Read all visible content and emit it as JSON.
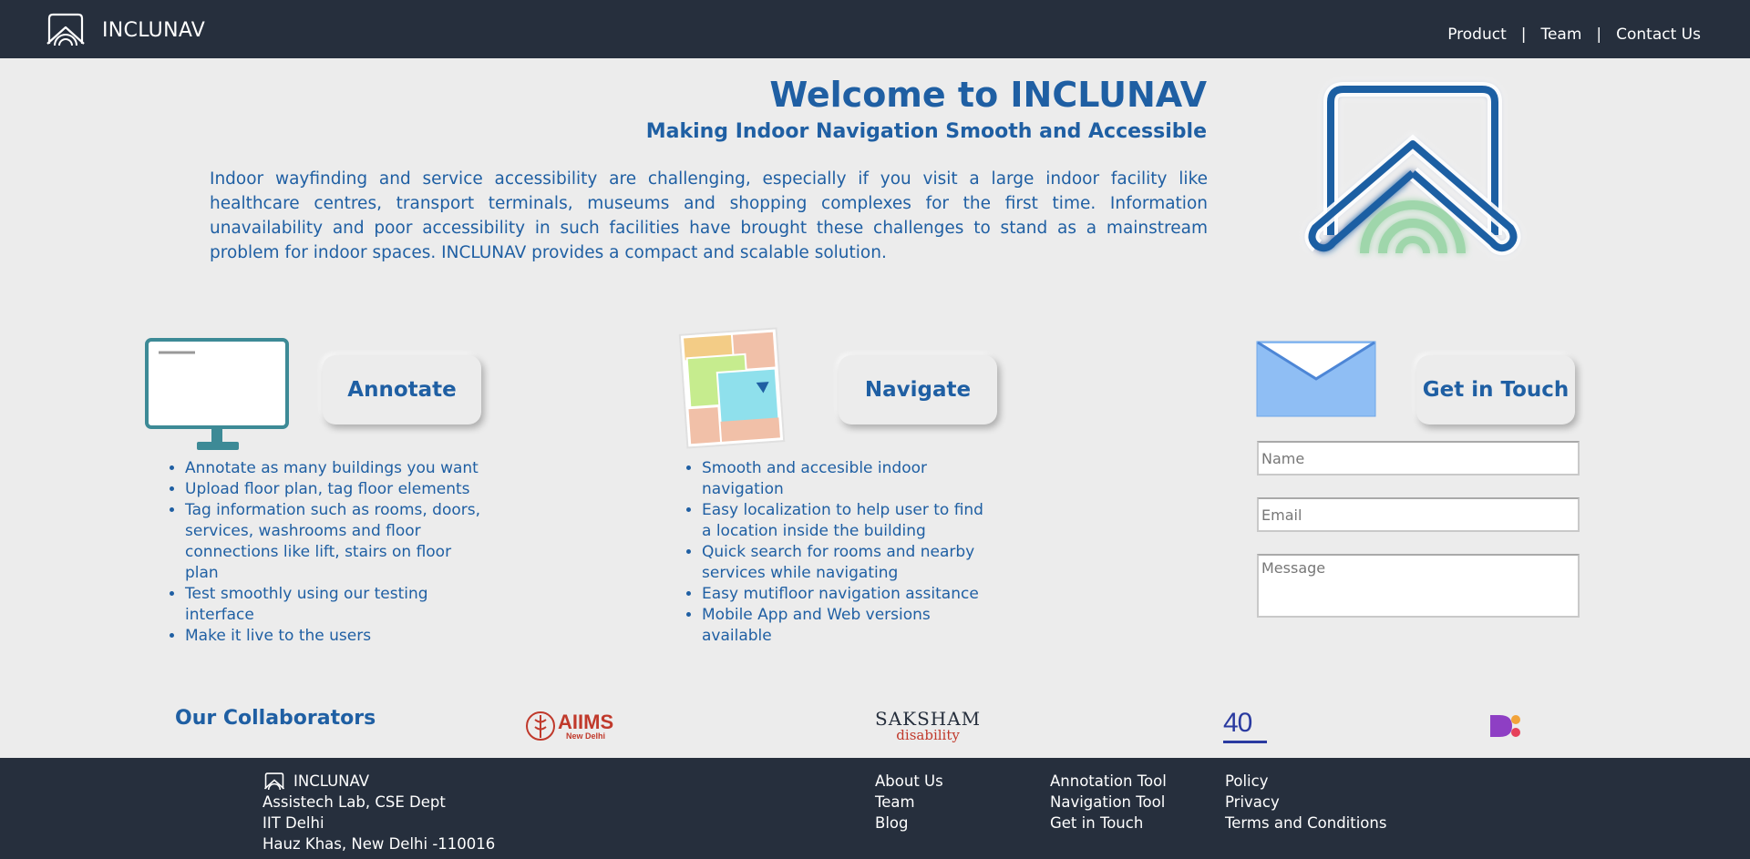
{
  "header": {
    "brand": "INCLUNAV",
    "nav": [
      "Product",
      "Team",
      "Contact Us"
    ],
    "separator": "|"
  },
  "hero": {
    "title": "Welcome to INCLUNAV",
    "subtitle": "Making Indoor Navigation Smooth and Accessible",
    "description": "Indoor wayfinding and service accessibility are challenging, especially if you visit a large indoor facility like healthcare centres, transport terminals, museums and shopping complexes for the first time. Information unavailability and poor accessibility in such facilities have brought these challenges to stand as a mainstream problem for indoor spaces. INCLUNAV provides a compact and scalable solution."
  },
  "features": {
    "annotate": {
      "button": "Annotate",
      "items": [
        "Annotate as many buildings you want",
        "Upload floor plan, tag floor elements",
        "Tag information such as rooms, doors, services, washrooms and floor connections like lift, stairs on floor plan",
        "Test smoothly using our testing interface",
        "Make it live to the users"
      ]
    },
    "navigate": {
      "button": "Navigate",
      "items": [
        "Smooth and accesible indoor navigation",
        "Easy localization to help user to find a location inside the building",
        "Quick search for rooms and nearby services while navigating",
        "Easy mutifloor navigation assitance",
        "Mobile App and Web versions available"
      ]
    },
    "contact": {
      "button": "Get in Touch",
      "name_placeholder": "Name",
      "email_placeholder": "Email",
      "message_placeholder": "Message"
    }
  },
  "collaborators": {
    "title": "Our Collaborators",
    "logos": [
      {
        "icon": "aiims-logo",
        "text": "AIIMS",
        "subtext": "New Delhi"
      },
      {
        "icon": "saksham-logo",
        "text": "SAKSHAM",
        "subtext": "disability"
      },
      {
        "icon": "40-years-logo",
        "text": "40"
      },
      {
        "icon": "d-logo",
        "text": ""
      }
    ]
  },
  "footer": {
    "brand": "INCLUNAV",
    "address": [
      "Assistech Lab, CSE Dept",
      "IIT Delhi",
      "Hauz Khas, New Delhi -110016"
    ],
    "col1": [
      "About Us",
      "Team",
      "Blog"
    ],
    "col2": [
      "Annotation Tool",
      "Navigation Tool",
      "Get in Touch"
    ],
    "col3": [
      "Policy",
      "Privacy",
      "Terms and Conditions"
    ]
  },
  "colors": {
    "header_bg": "#262f3d",
    "page_bg": "#ececec",
    "accent_blue": "#1f5fa3",
    "logo_green": "#9fd6ab"
  }
}
